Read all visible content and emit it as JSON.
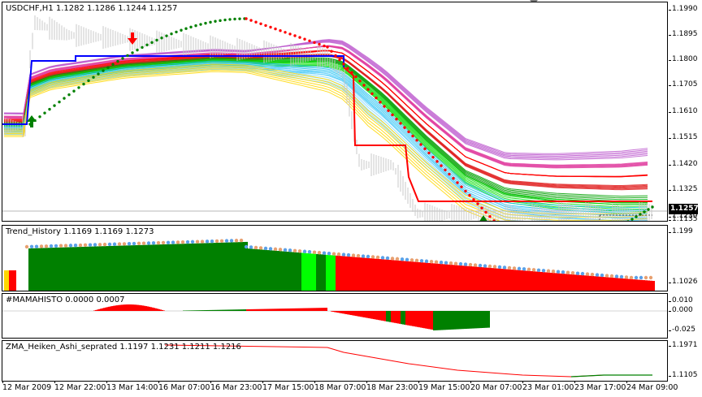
{
  "main": {
    "title": "USDCHF,H1  1.1282 1.1286 1.1244 1.1257",
    "price_badge": "1.1257",
    "ticks": [
      "1.1990",
      "1.1895",
      "1.1800",
      "1.1705",
      "1.1610",
      "1.1515",
      "1.1420",
      "1.1325",
      "1.1230",
      "1.1135"
    ]
  },
  "trend": {
    "title": "Trend_History 1.1169 1.1169 1.1273",
    "ticks": [
      "1.199",
      "1.1026"
    ]
  },
  "mama": {
    "title": "#MAMAHISTO 0.0000 0.0007",
    "ticks": [
      "0.010",
      "0.000",
      "-0.025"
    ]
  },
  "zma": {
    "title": "ZMA_Heiken_Ashi_seprated 1.1197 1.1231 1.1211 1.1216",
    "ticks": [
      "1.1971",
      "1.1105"
    ]
  },
  "xaxis": [
    "12 Mar 2009",
    "12 Mar 22:00",
    "13 Mar 14:00",
    "16 Mar 07:00",
    "16 Mar 23:00",
    "17 Mar 15:00",
    "18 Mar 07:00",
    "18 Mar 23:00",
    "19 Mar 15:00",
    "20 Mar 07:00",
    "23 Mar 01:00",
    "23 Mar 17:00",
    "24 Mar 09:00"
  ],
  "colors": {
    "up": "#008000",
    "down": "#ff0000",
    "blue": "#0000ff",
    "gold": "#ffd700",
    "lime": "#00ff00",
    "purple": "#c060d0"
  }
}
